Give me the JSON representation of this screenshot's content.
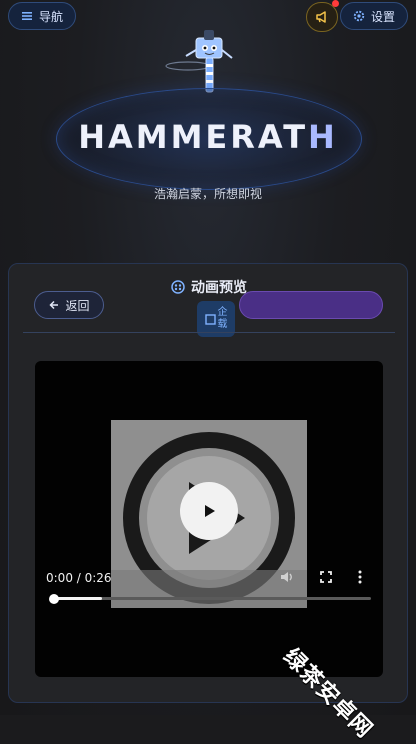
{
  "header": {
    "nav_label": "导航",
    "settings_label": "设置",
    "announcement_has_unread": true
  },
  "hero": {
    "brand_prefix": "HAMMERAT",
    "brand_suffix": "H",
    "slogan": "浩瀚启蒙，所想即视"
  },
  "panel": {
    "title": "动画预览",
    "back_label": "返回",
    "load_label_top": "企",
    "load_label_bottom": "载",
    "purple_button_label": ""
  },
  "video": {
    "time": "0:00 / 0:26",
    "progress_buffered_fraction": 0.16,
    "progress_played_fraction": 0.0
  },
  "watermark": "绿茶安卓网",
  "colors": {
    "accent_blue": "#2f4b7a",
    "accent_purple": "#4a2f86",
    "notification": "#ff3b3b",
    "background": "#1b1b1d"
  }
}
